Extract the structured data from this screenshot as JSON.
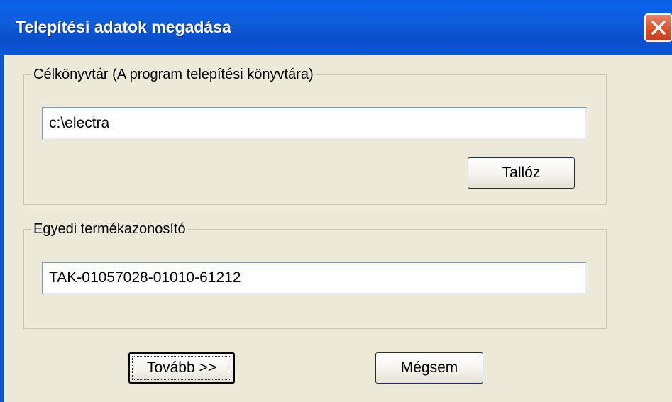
{
  "window": {
    "title": "Telepítési adatok megadása",
    "close_icon": "close-icon"
  },
  "target_dir_group": {
    "label": "Célkönyvtár (A program telepítési könyvtára)",
    "path_value": "c:\\electra",
    "browse_label": "Tallóz"
  },
  "product_id_group": {
    "label": "Egyedi termékazonosító",
    "id_value": "TAK-01057028-01010-61212"
  },
  "footer": {
    "next_label": "Tovább >>",
    "cancel_label": "Mégsem"
  },
  "colors": {
    "titlebar": "#0a5ce0",
    "window_bg": "#ece9d8",
    "close_button": "#d8542d"
  }
}
